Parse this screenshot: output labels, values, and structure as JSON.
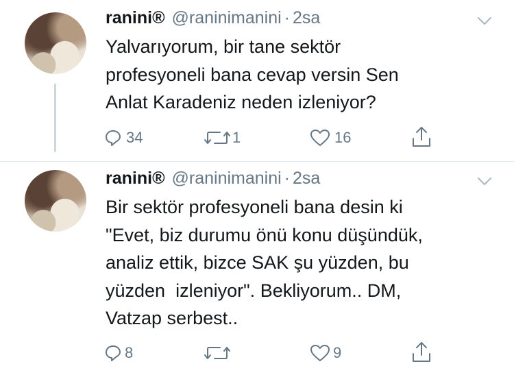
{
  "tweets": [
    {
      "name": "ranini®",
      "handle": "@raninimanini",
      "separator": "·",
      "time": "2sa",
      "text": "Yalvarıyorum, bir tane sektör\nprofesyoneli bana cevap versin Sen\nAnlat Karadeniz neden izleniyor?",
      "replies": "34",
      "retweets": "1",
      "likes": "16"
    },
    {
      "name": "ranini®",
      "handle": "@raninimanini",
      "separator": "·",
      "time": "2sa",
      "text": "Bir sektör profesyoneli bana desin ki\n\"Evet, biz durumu önü konu düşündük,\nanaliz ettik, bizce SAK şu yüzden, bu\nyüzden  izleniyor\". Bekliyorum.. DM,\nVatzap serbest..",
      "replies": "8",
      "retweets": "",
      "likes": "9"
    }
  ],
  "icons": {
    "reply": "reply-icon",
    "retweet": "retweet-icon",
    "like": "heart-icon",
    "share": "share-icon",
    "more": "chevron-down-icon"
  },
  "colors": {
    "text": "#14171a",
    "secondary": "#657786",
    "thread_line": "#ccd6dd"
  }
}
